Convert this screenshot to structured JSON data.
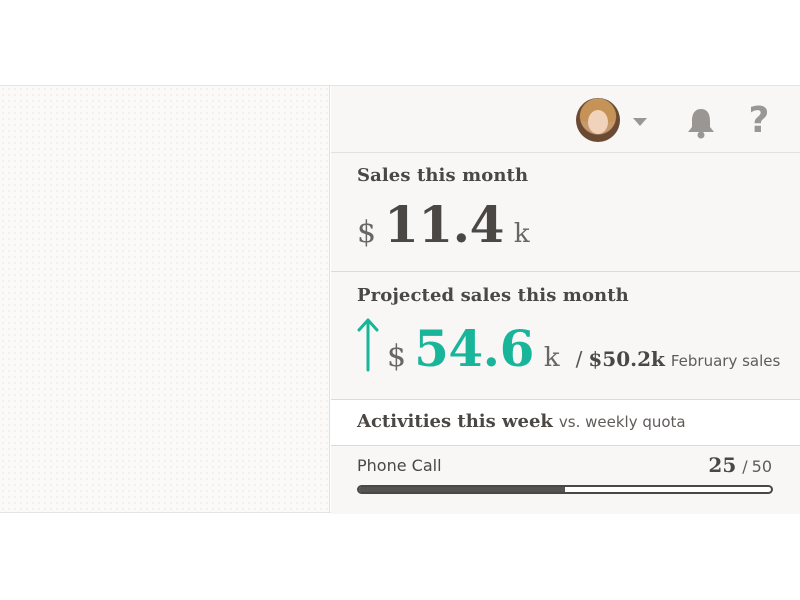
{
  "topbar": {
    "avatar_icon": "user-avatar",
    "dropdown_icon": "caret-down-icon",
    "bell_icon": "bell-icon",
    "help_icon": "question-mark-icon",
    "help_glyph": "?"
  },
  "sales": {
    "title": "Sales this month",
    "currency": "$",
    "amount": "11.4",
    "unit": "k"
  },
  "projected": {
    "title": "Projected sales this month",
    "trend_icon": "up-arrow-icon",
    "currency": "$",
    "amount": "54.6",
    "unit": "k",
    "separator": "/",
    "compare_amount": "$50.2k",
    "compare_label": "February sales",
    "accent_color": "#18b59a"
  },
  "activities": {
    "title": "Activities this week",
    "subtitle": "vs. weekly quota",
    "items": [
      {
        "label": "Phone Call",
        "done": "25",
        "separator": "/",
        "quota": "50",
        "progress_fraction": 0.5
      }
    ]
  }
}
